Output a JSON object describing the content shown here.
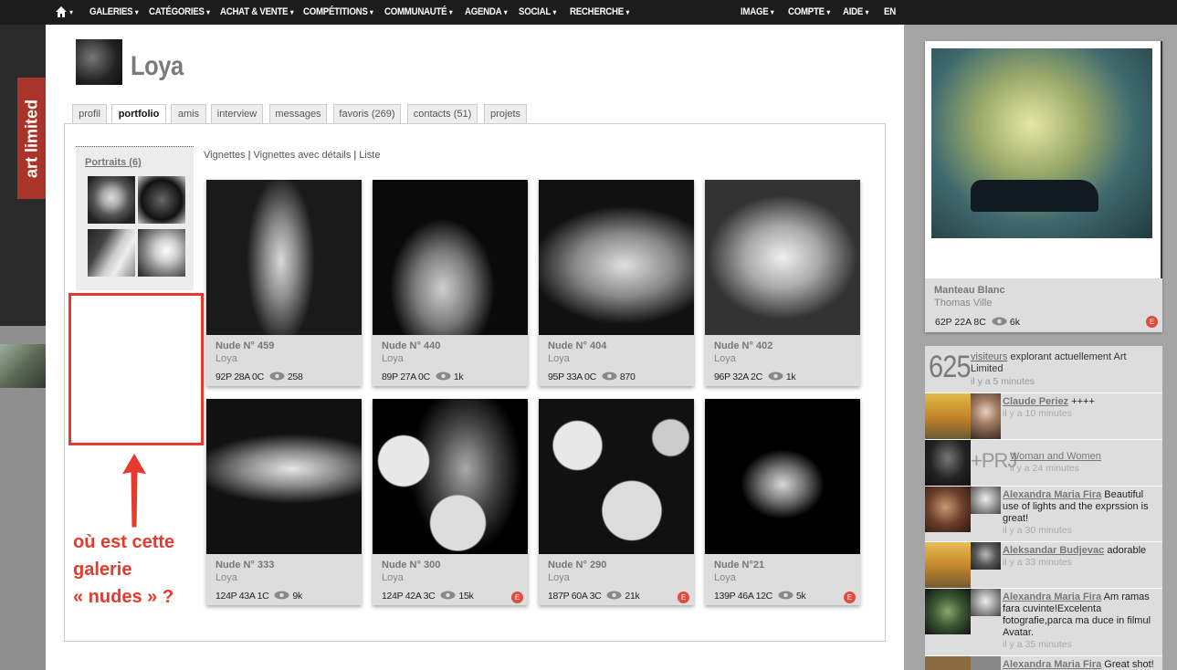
{
  "nav": {
    "items": [
      "GALERIES",
      "CATÉGORIES",
      "ACHAT & VENTE",
      "COMPÉTITIONS",
      "COMMUNAUTÉ",
      "AGENDA",
      "SOCIAL",
      "RECHERCHE"
    ],
    "right": [
      "IMAGE",
      "COMPTE",
      "AIDE"
    ],
    "lang": "EN"
  },
  "brand": "art limited",
  "profile": {
    "name": "Loya"
  },
  "tabs": [
    "profil",
    "portfolio",
    "amis",
    "interview",
    "messages",
    "favoris (269)",
    "contacts (51)",
    "projets"
  ],
  "active_tab": "portfolio",
  "sidebar": {
    "gallery_link": "Portraits (6)"
  },
  "annotation": {
    "line1": "où est cette",
    "line2": "galerie",
    "line3": "« nudes » ?"
  },
  "view_modes": [
    "Vignettes",
    "Vignettes avec détails",
    "Liste"
  ],
  "separator": "|",
  "photos": [
    {
      "title": "Nude N° 459",
      "author": "Loya",
      "stats": "92P 28A 0C",
      "views": "258",
      "badge": ""
    },
    {
      "title": "Nude N° 440",
      "author": "Loya",
      "stats": "89P 27A 0C",
      "views": "1k",
      "badge": ""
    },
    {
      "title": "Nude N° 404",
      "author": "Loya",
      "stats": "95P 33A 0C",
      "views": "870",
      "badge": ""
    },
    {
      "title": "Nude N° 402",
      "author": "Loya",
      "stats": "96P 32A 2C",
      "views": "1k",
      "badge": ""
    },
    {
      "title": "Nude N° 333",
      "author": "Loya",
      "stats": "124P 43A 1C",
      "views": "9k",
      "badge": ""
    },
    {
      "title": "Nude N° 300",
      "author": "Loya",
      "stats": "124P 42A 3C",
      "views": "15k",
      "badge": "E"
    },
    {
      "title": "Nude N° 290",
      "author": "Loya",
      "stats": "187P 60A 3C",
      "views": "21k",
      "badge": "E"
    },
    {
      "title": "Nude N°21",
      "author": "Loya",
      "stats": "139P 46A 12C",
      "views": "5k",
      "badge": "E"
    }
  ],
  "featured": {
    "title": "Manteau Blanc",
    "author": "Thomas Ville",
    "stats": "62P 22A 8C",
    "views": "6k",
    "badge": "E"
  },
  "activity": {
    "visitors_count": "625",
    "visitors_link": "visiteurs",
    "visitors_text": "explorant actuellement Art Limited",
    "visitors_time": "il y a 5 minutes",
    "items": [
      {
        "who": "Claude Periez",
        "text": "++++",
        "time": "il y a 10 minutes"
      },
      {
        "who": "",
        "prj": "+PRJ",
        "text": "Woman and Women",
        "time": "il y a 24 minutes"
      },
      {
        "who": "Alexandra Maria Fira",
        "text": "Beautiful use of lights and the exprssion is great!",
        "time": "il y a 30 minutes"
      },
      {
        "who": "Aleksandar Budjevac",
        "text": "adorable",
        "time": "il y a 33 minutes"
      },
      {
        "who": "Alexandra Maria Fira",
        "text": "Am ramas fara cuvinte!Excelenta fotografie,parca ma duce in filmul Avatar.",
        "time": "il y a 35 minutes"
      },
      {
        "who": "Alexandra Maria Fira",
        "text": "Great shot!",
        "time": ""
      }
    ]
  }
}
